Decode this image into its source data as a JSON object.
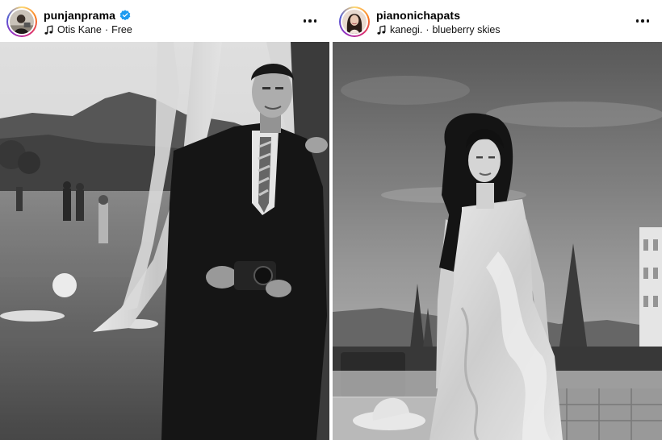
{
  "posts": [
    {
      "username": "punjanprama",
      "verified": true,
      "music_artist": "Otis Kane",
      "music_separator": "·",
      "music_track": "Free",
      "avatar_icon": "profile-avatar",
      "more_icon": "more-horizontal-icon",
      "photo_tone": "black-and-white",
      "ring_colors": [
        "#feda75",
        "#fa7e1e",
        "#d62976",
        "#962fbf",
        "#4f5bd5"
      ],
      "verified_color": "#1d9bf0"
    },
    {
      "username": "pianonichapats",
      "verified": false,
      "music_artist": "kanegi.",
      "music_separator": "·",
      "music_track": "blueberry skies",
      "avatar_icon": "profile-avatar",
      "more_icon": "more-horizontal-icon",
      "photo_tone": "black-and-white"
    }
  ]
}
